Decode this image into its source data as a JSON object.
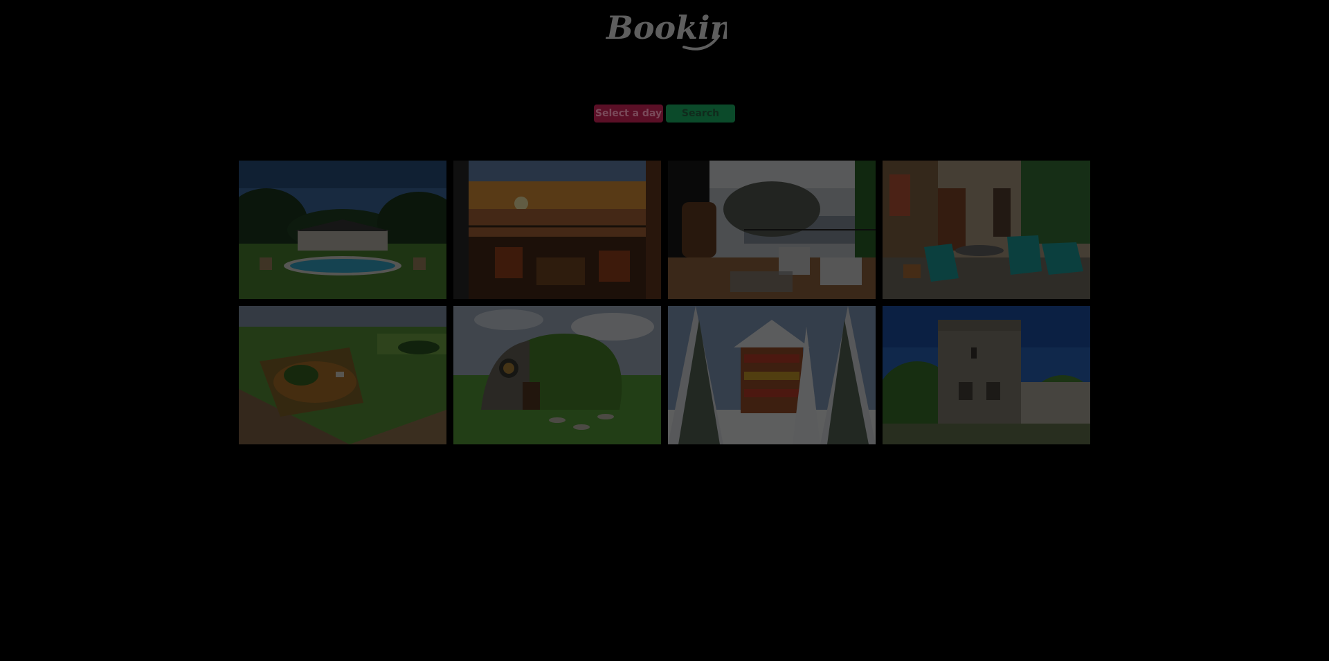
{
  "header": {
    "logo_text": "Booking"
  },
  "controls": {
    "select_day_label": "Select a day",
    "search_label": "Search"
  },
  "gallery": {
    "tiles": [
      {
        "subject": "villa-with-pool"
      },
      {
        "subject": "sunset-terrace"
      },
      {
        "subject": "lake-balcony-sauna"
      },
      {
        "subject": "stone-house-patio"
      },
      {
        "subject": "aerial-countryside-estate"
      },
      {
        "subject": "hobbit-house"
      },
      {
        "subject": "snowy-chalet"
      },
      {
        "subject": "stone-tower"
      }
    ]
  },
  "colors": {
    "background": "#000000",
    "select_day_bg": "#5a0f26",
    "search_bg": "#0b4a2a"
  }
}
